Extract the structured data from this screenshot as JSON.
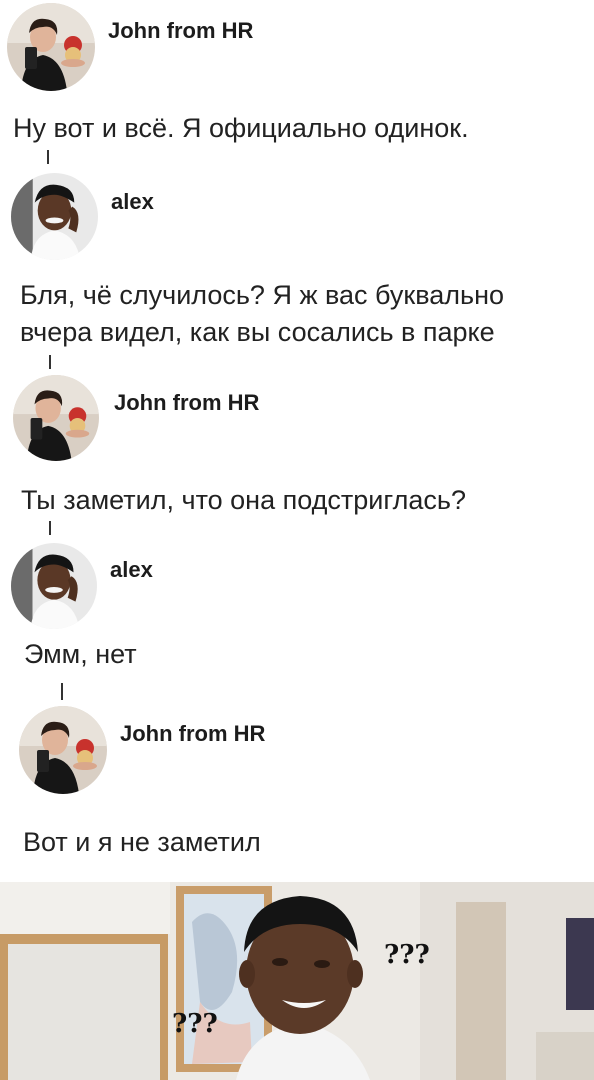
{
  "thread": [
    {
      "author": "John from HR",
      "avatar_icon": "john-selfie-avatar",
      "text_lines": [
        "Ну вот и всё. Я официально одинок."
      ]
    },
    {
      "author": "alex",
      "avatar_icon": "alex-phone-avatar",
      "text_lines": [
        "Бля, чё случилось? Я ж вас буквально",
        "вчера видел, как вы сосались в парке"
      ]
    },
    {
      "author": "John from HR",
      "avatar_icon": "john-selfie-avatar",
      "text_lines": [
        "Ты заметил, что она подстриглась?"
      ]
    },
    {
      "author": "alex",
      "avatar_icon": "alex-phone-avatar",
      "text_lines": [
        "Эмм, нет"
      ]
    },
    {
      "author": "John from HR",
      "avatar_icon": "john-selfie-avatar",
      "text_lines": [
        "Вот и я не заметил"
      ]
    }
  ],
  "meme": {
    "left_label": "???",
    "right_label": "???"
  }
}
